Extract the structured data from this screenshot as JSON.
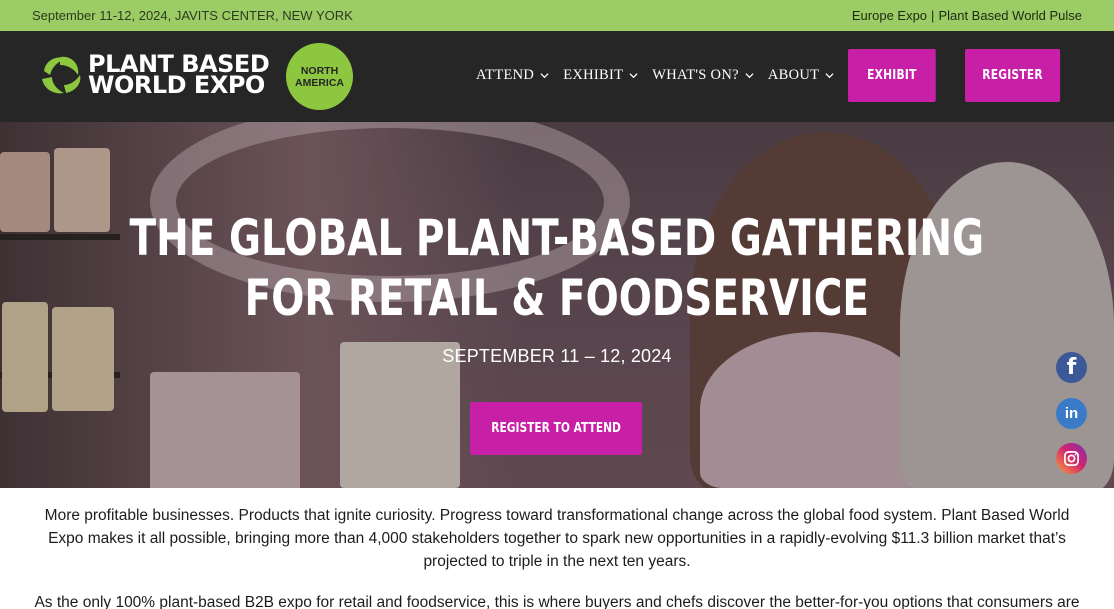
{
  "topbar": {
    "event_info": "September 11-12, 2024, JAVITS CENTER, NEW YORK",
    "link_europe": "Europe Expo",
    "separator": "|",
    "link_pulse": "Plant Based World Pulse"
  },
  "header": {
    "logo_line1": "PLANT BASED",
    "logo_line2": "WORLD EXPO",
    "region_line1": "NORTH",
    "region_line2": "AMERICA",
    "nav": [
      {
        "label": "ATTEND"
      },
      {
        "label": "EXHIBIT"
      },
      {
        "label": "WHAT'S ON?"
      },
      {
        "label": "ABOUT"
      }
    ],
    "exhibit_button": "EXHIBIT",
    "register_button": "REGISTER"
  },
  "hero": {
    "title_line1": "THE GLOBAL PLANT-BASED GATHERING",
    "title_line2": "FOR RETAIL & FOODSERVICE",
    "date": "SEPTEMBER 11 – 12, 2024",
    "cta": "REGISTER TO ATTEND"
  },
  "social": {
    "facebook_icon": "f",
    "linkedin_icon": "in"
  },
  "content": {
    "paragraph1": "More profitable businesses. Products that ignite curiosity. Progress toward transformational change across the global food system. Plant Based World Expo makes it all possible, bringing more than 4,000 stakeholders together to spark new opportunities in a rapidly-evolving $11.3 billion market that’s projected to triple in the next ten years.",
    "paragraph2": "As the only 100% plant-based B2B expo for retail and foodservice, this is where buyers and chefs discover the better-for-you options that consumers are"
  },
  "colors": {
    "topbar_green": "#9ccc65",
    "header_dark": "#262626",
    "accent_magenta": "#c81fa7",
    "badge_green": "#8dc63f"
  }
}
